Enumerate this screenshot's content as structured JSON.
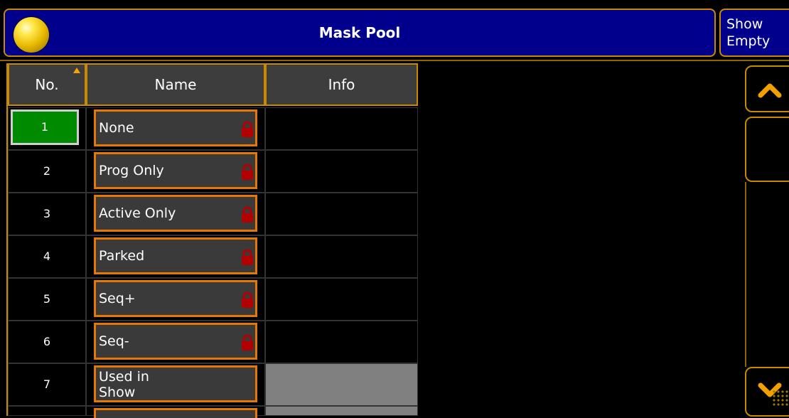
{
  "window": {
    "title": "Mask Pool",
    "show_empty_line1": "Show",
    "show_empty_line2": "Empty"
  },
  "table": {
    "headers": {
      "no": "No.",
      "name": "Name",
      "info": "Info"
    },
    "sort_column": "No.",
    "rows": [
      {
        "no": "1",
        "name": "None",
        "locked": true,
        "selected": true,
        "info": ""
      },
      {
        "no": "2",
        "name": "Prog Only",
        "locked": true,
        "info": ""
      },
      {
        "no": "3",
        "name": "Active Only",
        "locked": true,
        "info": ""
      },
      {
        "no": "4",
        "name": "Parked",
        "locked": true,
        "info": ""
      },
      {
        "no": "5",
        "name": "Seq+",
        "locked": true,
        "info": ""
      },
      {
        "no": "6",
        "name": "Seq-",
        "locked": true,
        "info": ""
      },
      {
        "no": "7",
        "name_line1": "Used in",
        "name_line2": "Show",
        "locked": false,
        "info": ""
      }
    ]
  },
  "colors": {
    "title_bg": "#00008c",
    "accent_border": "#c88a00",
    "name_border": "#e3780a",
    "selected_bg": "#008a00",
    "lock": "#b30000"
  },
  "icons": {
    "logo": "yellow-ball-icon",
    "lock": "lock-icon",
    "scroll_up": "chevron-up-icon",
    "scroll_down": "chevron-down-icon"
  }
}
